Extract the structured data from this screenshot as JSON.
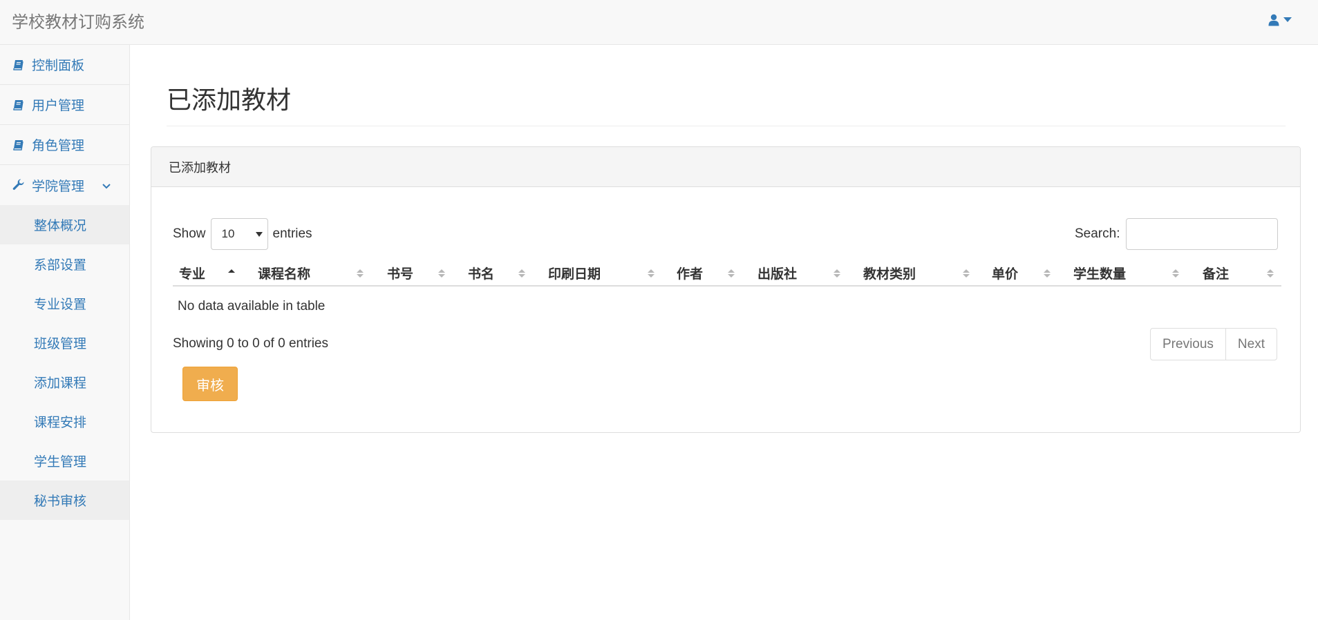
{
  "app": {
    "brand": "学校教材订购系统"
  },
  "navbar": {
    "user_icon": "user-icon",
    "caret_icon": "caret-down-icon"
  },
  "sidebar": {
    "items": [
      {
        "label": "控制面板",
        "icon": "book-icon"
      },
      {
        "label": "用户管理",
        "icon": "book-icon"
      },
      {
        "label": "角色管理",
        "icon": "book-icon"
      },
      {
        "label": "学院管理",
        "icon": "wrench-icon",
        "expanded": true
      }
    ],
    "sub_items": [
      {
        "label": "整体概况",
        "active": true
      },
      {
        "label": "系部设置",
        "active": false
      },
      {
        "label": "专业设置",
        "active": false
      },
      {
        "label": "班级管理",
        "active": false
      },
      {
        "label": "添加课程",
        "active": false
      },
      {
        "label": "课程安排",
        "active": false
      },
      {
        "label": "学生管理",
        "active": false
      },
      {
        "label": "秘书审核",
        "active": true
      }
    ]
  },
  "main": {
    "page_title": "已添加教材",
    "panel_title": "已添加教材",
    "length": {
      "show_label": "Show",
      "value": "10",
      "entries_label": "entries"
    },
    "search": {
      "label": "Search:",
      "value": "",
      "placeholder": ""
    },
    "columns": [
      "专业",
      "课程名称",
      "书号",
      "书名",
      "印刷日期",
      "作者",
      "出版社",
      "教材类别",
      "单价",
      "学生数量",
      "备注"
    ],
    "sorted_column": "专业",
    "empty_message": "No data available in table",
    "info": "Showing 0 to 0 of 0 entries",
    "pagination": {
      "previous": "Previous",
      "next": "Next"
    },
    "review_button": "审核"
  },
  "colors": {
    "link": "#337ab7",
    "warning": "#f0ad4e",
    "navbar_bg": "#f8f8f8"
  }
}
